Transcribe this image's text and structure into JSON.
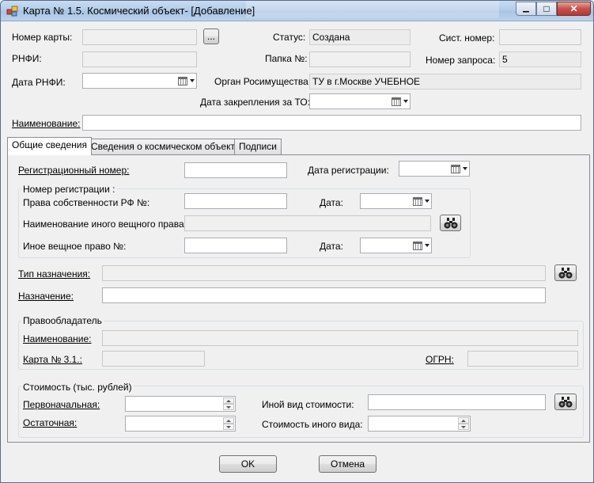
{
  "window": {
    "title": "Карта № 1.5. Космический объект- [Добавление]",
    "min_glyph": "▁",
    "max_glyph": "□",
    "close_glyph": "✕"
  },
  "header": {
    "card_number_label": "Номер карты:",
    "card_number_value": "",
    "browse_button": "...",
    "status_label": "Статус:",
    "status_value": "Создана",
    "sys_number_label": "Сист. номер:",
    "sys_number_value": "",
    "rnfi_label": "РНФИ:",
    "rnfi_value": "",
    "folder_label": "Папка №:",
    "folder_value": "",
    "request_number_label": "Номер запроса:",
    "request_number_value": "5",
    "rnfi_date_label": "Дата РНФИ:",
    "rnfi_date_value": "",
    "authority_label": "Орган Росимущества:",
    "authority_value": "ТУ в г.Москве УЧЕБНОЕ",
    "assign_date_label": "Дата закрепления за ТО:",
    "assign_date_value": "",
    "name_label": "Наименование:",
    "name_value": ""
  },
  "tabs": [
    {
      "label": "Общие сведения",
      "active": true
    },
    {
      "label": "Сведения о космическом объекте",
      "active": false
    },
    {
      "label": "Подписи",
      "active": false
    }
  ],
  "general": {
    "reg_number_label": "Регистрационный номер:",
    "reg_number_value": "",
    "reg_date_label": "Дата регистрации:",
    "reg_date_value": "",
    "reg_group_title": "Номер регистрации :",
    "ownership_label": "Права собственности РФ №:",
    "ownership_value": "",
    "ownership_date_label": "Дата:",
    "ownership_date_value": "",
    "other_right_name_label": "Наименование иного вещного права:",
    "other_right_name_value": "",
    "other_right_label": "Иное вещное право №:",
    "other_right_value": "",
    "other_right_date_label": "Дата:",
    "other_right_date_value": "",
    "purpose_type_label": "Тип назначения:",
    "purpose_type_value": "",
    "purpose_label": "Назначение:",
    "purpose_value": ""
  },
  "holder": {
    "group_title": "Правообладатель",
    "name_label": "Наименование:",
    "name_value": "",
    "card_label": "Карта № 3.1.:",
    "card_value": "",
    "ogrn_label": "ОГРН:",
    "ogrn_value": ""
  },
  "cost": {
    "group_title": "Стоимость (тыс. рублей)",
    "initial_label": "Первоначальная:",
    "initial_value": "",
    "residual_label": "Остаточная:",
    "residual_value": "",
    "other_type_label": "Иной вид стоимости:",
    "other_type_value": "",
    "other_cost_label": "Стоимость иного вида:",
    "other_cost_value": ""
  },
  "footer": {
    "ok_label": "OK",
    "cancel_label": "Отмена"
  },
  "icons": {
    "search": "binoculars-icon",
    "calendar": "calendar-icon",
    "app": "app-icon"
  }
}
